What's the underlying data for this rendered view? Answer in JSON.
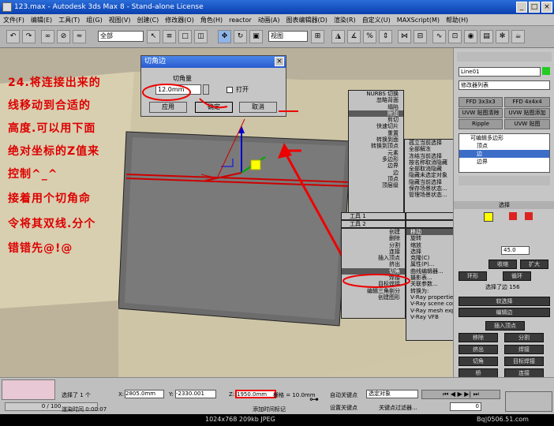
{
  "window": {
    "title": "123.max - Autodesk 3ds Max 8 - Stand-alone License"
  },
  "menu": [
    "文件(F)",
    "编辑(E)",
    "工具(T)",
    "组(G)",
    "视图(V)",
    "创建(C)",
    "修改器(O)",
    "角色(H)",
    "reactor",
    "动画(A)",
    "图表编辑器(D)",
    "渲染(R)",
    "自定义(U)",
    "MAXScript(M)",
    "帮助(H)"
  ],
  "toolbar": {
    "filter": "全部",
    "coord": "视图"
  },
  "viewport": {
    "label": "透视"
  },
  "annotation": [
    "24.将连接出来的",
    "线移动到合适的",
    "高度.可以用下面",
    "绝对坐标的Z值来",
    "控制^_^",
    "接着用个切角命",
    "令将其双线.分个",
    "错错先@!@"
  ],
  "dialog": {
    "title": "切角边",
    "field_label": "切角量",
    "value": "12.0mm",
    "open_label": "打开",
    "apply": "应用",
    "ok": "确定",
    "cancel": "取消"
  },
  "menu_left1": [
    "NURBS 切换",
    "忽略背面",
    "塌陷",
    "附加",
    "剪切",
    "快速切片",
    "重置",
    "转换到面",
    "转换到顶点",
    "元素",
    "多边形",
    "边界",
    "边",
    "顶点",
    "顶层级"
  ],
  "menu_right1": [
    "孤立当前选择",
    "全部解冻",
    "冻结当前选择",
    "按名称取消隐藏",
    "全部取消隐藏",
    "隐藏未选定对象",
    "隐藏当前选择",
    "保存场景状态...",
    "管理场景状态..."
  ],
  "menu_headers": {
    "tools1": "工具 1",
    "display": "显示",
    "tools2": "工具 2",
    "transform": "变换"
  },
  "menu_left2": [
    "创建",
    "删除",
    "分割",
    "连接",
    "插入顶点",
    "挤出",
    "切角",
    "焊接",
    "目标焊接",
    "编辑三角剖分",
    "创建图形"
  ],
  "menu_right2": [
    "移动",
    "旋转",
    "缩放",
    "选择",
    "克隆(C)",
    "属性(P)...",
    "曲线编辑器...",
    "摄影表...",
    "关联参数...",
    "转换为:",
    "V-Ray properties",
    "V-Ray scene converter",
    "V-Ray mesh export",
    "V-Ray VFB"
  ],
  "rpanel": {
    "object": "Line01",
    "modlist": "修改器列表",
    "btns": [
      "FFD 3x3x3",
      "FFD 4x4x4",
      "UVW 贴图清除",
      "UVW 贴图添加",
      "Ripple",
      "UVW 贴图"
    ],
    "stack": [
      "可编辑多边形",
      "顶点",
      "边",
      "边界"
    ],
    "select": "选择",
    "rows": [
      "收缩",
      "扩大",
      "环形",
      "循环",
      "选择了边 156",
      "软选择",
      "编辑边",
      "插入顶点",
      "移除",
      "分割",
      "挤出",
      "焊接",
      "切角",
      "目标焊接",
      "桥",
      "连接"
    ],
    "tab_scroll_value": "45.0"
  },
  "status": {
    "progress": "0 / 100",
    "selected": "选择了 1 个",
    "x": "2805.0mm",
    "y": "-2330.001",
    "z": "1950.0mm",
    "grid": "栅格 = 10.0mm",
    "auto_key": "自动关键点",
    "selected_obj": "选定对象",
    "set_key": "设置关键点",
    "key_filter": "关键点过滤器...",
    "render_time": "渲染时间  0:00:07",
    "add_tag": "添加时间标记",
    "frame": "0"
  },
  "footer": {
    "info": "1024x768  209kb  JPEG",
    "watermark": "Bq|0506.51.com"
  },
  "colors": {
    "red": "#dd0000",
    "title_blue": "#0a3fb0",
    "viewport": "#cfc6a8"
  }
}
